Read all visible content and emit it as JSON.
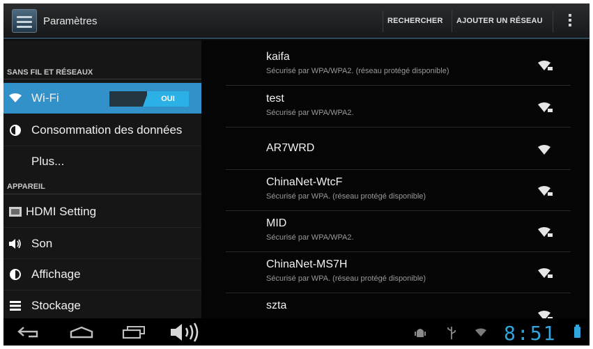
{
  "action_bar": {
    "title": "Paramètres",
    "search_label": "RECHERCHER",
    "add_network_label": "AJOUTER UN RÉSEAU",
    "overflow_icon": "overflow-menu-icon"
  },
  "sidebar": {
    "sections": [
      {
        "header": "SANS FIL ET RÉSEAUX"
      },
      {
        "header": "APPAREIL"
      }
    ],
    "items": [
      {
        "label": "Wi-Fi",
        "icon": "wifi-icon",
        "selected": true,
        "toggle": "OUI"
      },
      {
        "label": "Consommation des données",
        "icon": "data-usage-icon"
      },
      {
        "label": "Plus...",
        "icon": ""
      },
      {
        "label": "HDMI Setting",
        "icon": "hdmi-icon"
      },
      {
        "label": "Son",
        "icon": "sound-icon"
      },
      {
        "label": "Affichage",
        "icon": "display-icon"
      },
      {
        "label": "Stockage",
        "icon": "storage-icon"
      }
    ]
  },
  "networks": [
    {
      "name": "kaifa",
      "status": "Sécurisé par WPA/WPA2. (réseau protégé disponible)",
      "secured": true
    },
    {
      "name": "test",
      "status": "Sécurisé par WPA/WPA2.",
      "secured": true
    },
    {
      "name": "AR7WRD",
      "status": "",
      "secured": false
    },
    {
      "name": "ChinaNet-WtcF",
      "status": "Sécurisé par WPA. (réseau protégé disponible)",
      "secured": true
    },
    {
      "name": "MID",
      "status": "Sécurisé par WPA/WPA2.",
      "secured": true
    },
    {
      "name": "ChinaNet-MS7H",
      "status": "Sécurisé par WPA. (réseau protégé disponible)",
      "secured": true
    },
    {
      "name": "szta",
      "status": "",
      "secured": true
    }
  ],
  "status_bar": {
    "time": "8:51",
    "accent_color": "#2fa6dd"
  }
}
